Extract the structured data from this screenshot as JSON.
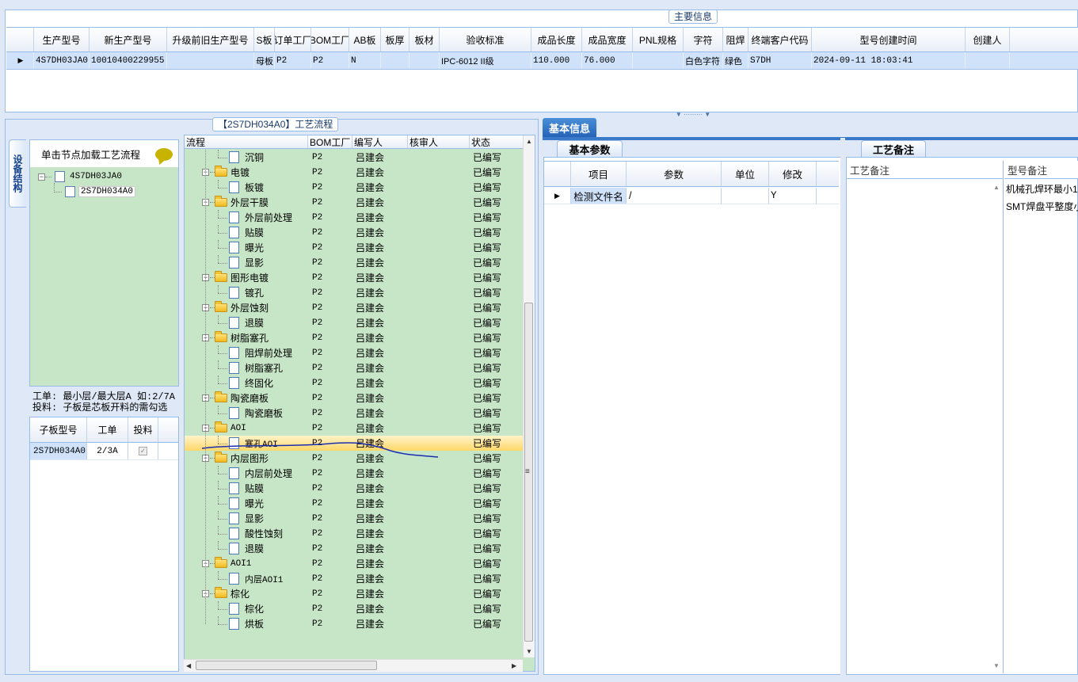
{
  "main_info": {
    "title": "主要信息",
    "columns": [
      "生产型号",
      "新生产型号",
      "升级前旧生产型号",
      "S板",
      "订单工厂",
      "BOM工厂",
      "AB板",
      "板厚",
      "板材",
      "验收标准",
      "成品长度",
      "成品宽度",
      "PNL规格",
      "字符",
      "阻焊",
      "终端客户代码",
      "型号创建时间",
      "创建人"
    ],
    "row": [
      "4S7DH03JA0",
      "10010400229955",
      "",
      "母板",
      "P2",
      "P2",
      "N",
      "",
      "",
      "IPC-6012 II级",
      "110.000",
      "76.000",
      "",
      "白色字符",
      "绿色",
      "S7DH",
      "2024-09-11 18:03:41",
      ""
    ],
    "row_indicator": "▶"
  },
  "process": {
    "title": "【2S7DH034A0】工艺流程",
    "side_tab": "设备结构",
    "tree_hint": "单击节点加载工艺流程",
    "tree_root": "4S7DH03JA0",
    "tree_child": "2S7DH034A0",
    "note_line1": "工单: 最小层/最大层A 如:2/7A",
    "note_line2": "投料: 子板是芯板开料的需勾选",
    "sub_columns": [
      "子板型号",
      "工单",
      "投料"
    ],
    "sub_row": {
      "model": "2S7DH034A0",
      "order": "2/3A",
      "check": "✓"
    }
  },
  "flow": {
    "columns": [
      "流程",
      "BOM工厂",
      "编写人",
      "核审人",
      "状态"
    ],
    "rows": [
      {
        "level": 1,
        "name": "沉铜",
        "bom": "P2",
        "writer": "吕建会",
        "status": "已编写"
      },
      {
        "level": 0,
        "name": "电镀",
        "bom": "P2",
        "writer": "吕建会",
        "status": "已编写"
      },
      {
        "level": 1,
        "name": "板镀",
        "bom": "P2",
        "writer": "吕建会",
        "status": "已编写"
      },
      {
        "level": 0,
        "name": "外层干膜",
        "bom": "P2",
        "writer": "吕建会",
        "status": "已编写"
      },
      {
        "level": 1,
        "name": "外层前处理",
        "bom": "P2",
        "writer": "吕建会",
        "status": "已编写"
      },
      {
        "level": 1,
        "name": "贴膜",
        "bom": "P2",
        "writer": "吕建会",
        "status": "已编写"
      },
      {
        "level": 1,
        "name": "曝光",
        "bom": "P2",
        "writer": "吕建会",
        "status": "已编写"
      },
      {
        "level": 1,
        "name": "显影",
        "bom": "P2",
        "writer": "吕建会",
        "status": "已编写"
      },
      {
        "level": 0,
        "name": "图形电镀",
        "bom": "P2",
        "writer": "吕建会",
        "status": "已编写"
      },
      {
        "level": 1,
        "name": "镀孔",
        "bom": "P2",
        "writer": "吕建会",
        "status": "已编写"
      },
      {
        "level": 0,
        "name": "外层蚀刻",
        "bom": "P2",
        "writer": "吕建会",
        "status": "已编写"
      },
      {
        "level": 1,
        "name": "退膜",
        "bom": "P2",
        "writer": "吕建会",
        "status": "已编写"
      },
      {
        "level": 0,
        "name": "树脂塞孔",
        "bom": "P2",
        "writer": "吕建会",
        "status": "已编写"
      },
      {
        "level": 1,
        "name": "阻焊前处理",
        "bom": "P2",
        "writer": "吕建会",
        "status": "已编写"
      },
      {
        "level": 1,
        "name": "树脂塞孔",
        "bom": "P2",
        "writer": "吕建会",
        "status": "已编写"
      },
      {
        "level": 1,
        "name": "终固化",
        "bom": "P2",
        "writer": "吕建会",
        "status": "已编写"
      },
      {
        "level": 0,
        "name": "陶瓷磨板",
        "bom": "P2",
        "writer": "吕建会",
        "status": "已编写"
      },
      {
        "level": 1,
        "name": "陶瓷磨板",
        "bom": "P2",
        "writer": "吕建会",
        "status": "已编写"
      },
      {
        "level": 0,
        "name": "AOI",
        "bom": "P2",
        "writer": "吕建会",
        "status": "已编写"
      },
      {
        "level": 1,
        "name": "塞孔AOI",
        "bom": "P2",
        "writer": "吕建会",
        "status": "已编写",
        "selected": true
      },
      {
        "level": 0,
        "name": "内层图形",
        "bom": "P2",
        "writer": "吕建会",
        "status": "已编写"
      },
      {
        "level": 1,
        "name": "内层前处理",
        "bom": "P2",
        "writer": "吕建会",
        "status": "已编写"
      },
      {
        "level": 1,
        "name": "贴膜",
        "bom": "P2",
        "writer": "吕建会",
        "status": "已编写"
      },
      {
        "level": 1,
        "name": "曝光",
        "bom": "P2",
        "writer": "吕建会",
        "status": "已编写"
      },
      {
        "level": 1,
        "name": "显影",
        "bom": "P2",
        "writer": "吕建会",
        "status": "已编写"
      },
      {
        "level": 1,
        "name": "酸性蚀刻",
        "bom": "P2",
        "writer": "吕建会",
        "status": "已编写"
      },
      {
        "level": 1,
        "name": "退膜",
        "bom": "P2",
        "writer": "吕建会",
        "status": "已编写"
      },
      {
        "level": 0,
        "name": "AOI1",
        "bom": "P2",
        "writer": "吕建会",
        "status": "已编写"
      },
      {
        "level": 1,
        "name": "内层AOI1",
        "bom": "P2",
        "writer": "吕建会",
        "status": "已编写"
      },
      {
        "level": 0,
        "name": "棕化",
        "bom": "P2",
        "writer": "吕建会",
        "status": "已编写"
      },
      {
        "level": 1,
        "name": "棕化",
        "bom": "P2",
        "writer": "吕建会",
        "status": "已编写"
      },
      {
        "level": 1,
        "name": "烘板",
        "bom": "P2",
        "writer": "吕建会",
        "status": "已编写"
      }
    ]
  },
  "basic": {
    "tab": "基本信息",
    "param_tab": "基本参数",
    "param_columns": [
      "项目",
      "参数",
      "单位",
      "修改"
    ],
    "param_row": {
      "item": "检测文件名",
      "value": "/",
      "unit": "",
      "edit": "Y"
    },
    "craft_tab": "工艺备注",
    "craft_col1": "工艺备注",
    "craft_col2": "型号备注",
    "craft_notes": [
      "机械孔焊环最小1",
      "SMT焊盘平整度小"
    ]
  },
  "colors": {
    "accent": "#2563b8",
    "green_bg": "#c7e5c7",
    "selected_row": "#ffd86a",
    "annotation_stroke": "#1a2fb0"
  }
}
